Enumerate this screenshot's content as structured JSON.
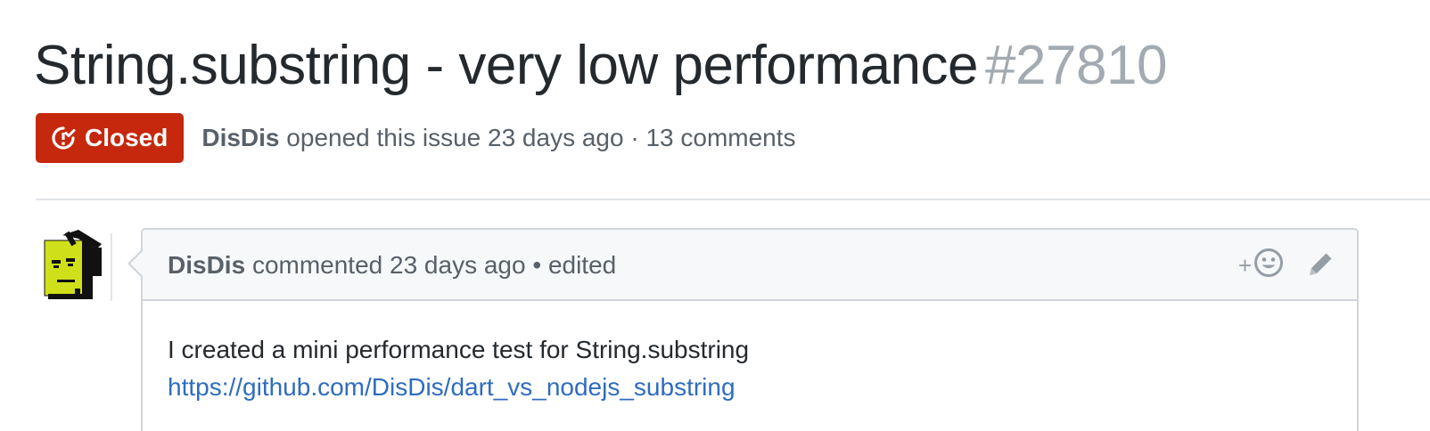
{
  "issue": {
    "title": "String.substring - very low performance",
    "number": "#27810",
    "state": "Closed",
    "state_color": "#c5280d",
    "author": "DisDis",
    "opened_text": "opened this issue 23 days ago",
    "separator": "·",
    "comments_count": "13 comments"
  },
  "comment": {
    "author": "DisDis",
    "action_text": "commented 23 days ago",
    "edited_text": "• edited",
    "reaction_plus": "+",
    "body_line1": "I created a mini performance test for String.substring",
    "body_link": "https://github.com/DisDis/dart_vs_nodejs_substring"
  },
  "icons": {
    "state": "issue-closed-icon",
    "reaction": "smiley-icon",
    "edit": "pencil-icon",
    "avatar": "user-avatar"
  }
}
